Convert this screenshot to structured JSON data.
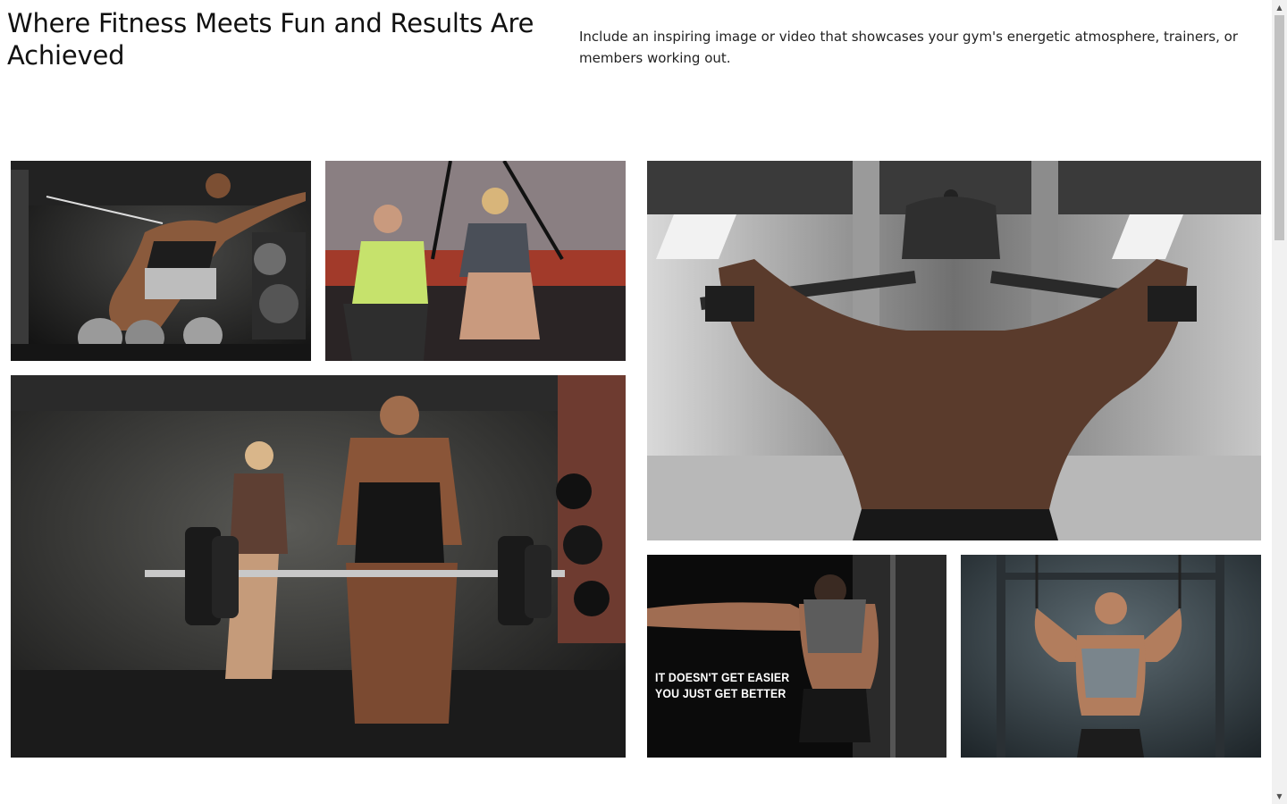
{
  "hero": {
    "headline": "Where Fitness Meets Fun and Results Are Achieved",
    "description": "Include an inspiring image or video that showcases your gym's energetic atmosphere, trainers, or members working out."
  },
  "gallery": {
    "poster_text": "IT DOESN'T GET EASIER\nYOU JUST GET BETTER"
  },
  "scrollbar": {
    "up_icon": "▲",
    "down_icon": "▼",
    "position_fraction": 0
  },
  "colors": {
    "background": "#ffffff",
    "text": "#111111",
    "scroll_track": "#f1f1f1",
    "scroll_thumb": "#c1c1c1"
  }
}
